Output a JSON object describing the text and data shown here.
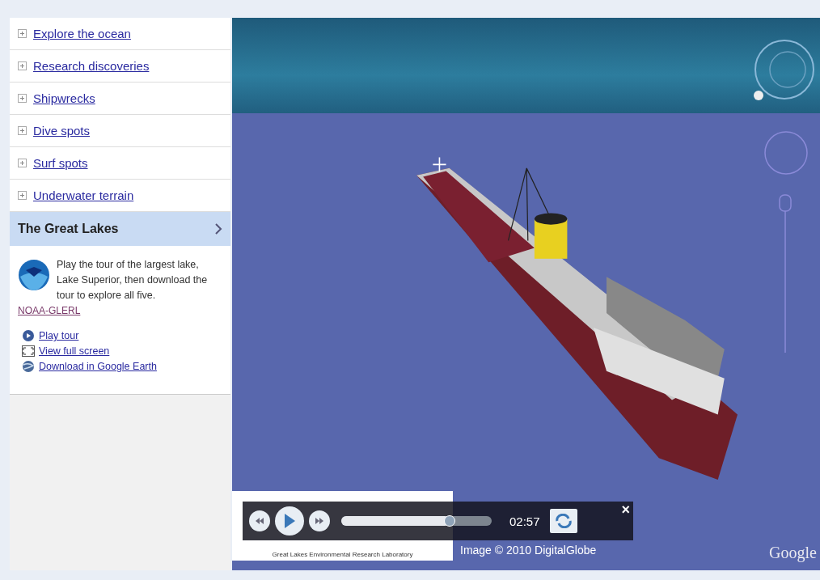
{
  "sidebar": {
    "items": [
      {
        "label": "Explore the ocean",
        "selected": false
      },
      {
        "label": "Research discoveries",
        "selected": false
      },
      {
        "label": "Shipwrecks",
        "selected": false
      },
      {
        "label": "Dive spots",
        "selected": false
      },
      {
        "label": "Surf spots",
        "selected": false
      },
      {
        "label": "Underwater terrain",
        "selected": false
      },
      {
        "label": "The Great Lakes",
        "selected": true
      }
    ],
    "detail": {
      "description": "Play the tour of the largest lake, Lake Superior, then download the tour to explore all five.",
      "source_link": "NOAA-GLERL",
      "actions": [
        {
          "kind": "play",
          "label": "Play tour"
        },
        {
          "kind": "fullscreen",
          "label": "View full screen"
        },
        {
          "kind": "earth",
          "label": "Download in Google Earth"
        }
      ]
    }
  },
  "map": {
    "logo_caption": "Great Lakes Environmental Research Laboratory",
    "attribution": "Image © 2010 DigitalGlobe",
    "brand": "Google",
    "player": {
      "level": 0.72,
      "time": "02:57",
      "close": "×"
    }
  }
}
